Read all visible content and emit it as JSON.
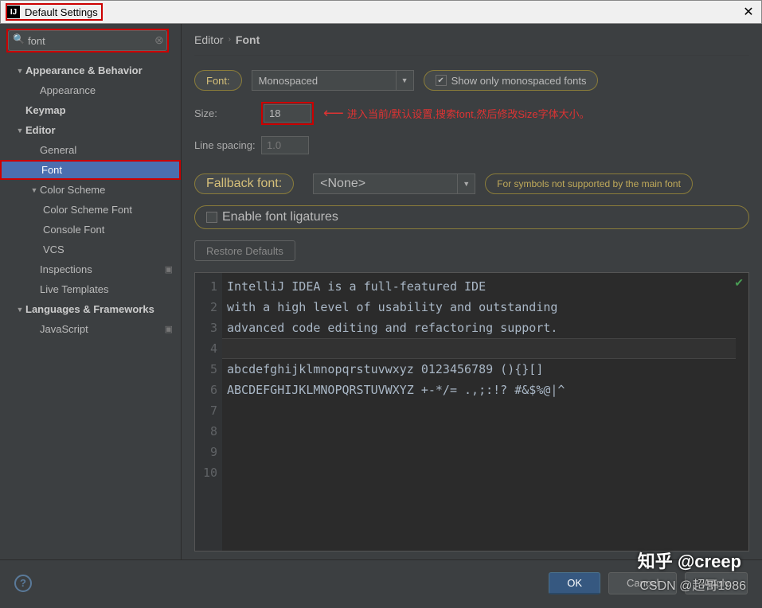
{
  "window": {
    "title": "Default Settings"
  },
  "search": {
    "value": "font"
  },
  "tree": {
    "appearance_behavior": "Appearance & Behavior",
    "appearance": "Appearance",
    "keymap": "Keymap",
    "editor": "Editor",
    "general": "General",
    "font": "Font",
    "color_scheme": "Color Scheme",
    "color_scheme_font": "Color Scheme Font",
    "console_font": "Console Font",
    "vcs": "VCS",
    "inspections": "Inspections",
    "live_templates": "Live Templates",
    "languages_frameworks": "Languages & Frameworks",
    "javascript": "JavaScript"
  },
  "breadcrumb": {
    "root": "Editor",
    "leaf": "Font"
  },
  "form": {
    "font_label": "Font:",
    "font_value": "Monospaced",
    "show_monospaced": "Show only monospaced fonts",
    "size_label": "Size:",
    "size_value": "18",
    "line_spacing_label": "Line spacing:",
    "line_spacing_value": "1.0",
    "fallback_label": "Fallback font:",
    "fallback_value": "<None>",
    "fallback_hint": "For symbols not supported by the main font",
    "ligatures": "Enable font ligatures",
    "restore": "Restore Defaults",
    "annotation": "进入当前/默认设置,搜索font,然后修改Size字体大小。"
  },
  "preview": {
    "lines": [
      "IntelliJ IDEA is a full-featured IDE",
      "with a high level of usability and outstanding",
      "advanced code editing and refactoring support.",
      "",
      "abcdefghijklmnopqrstuvwxyz 0123456789 (){}[]",
      "ABCDEFGHIJKLMNOPQRSTUVWXYZ +-*/= .,;:!? #&$%@|^",
      "",
      "",
      "",
      ""
    ]
  },
  "footer": {
    "ok": "OK",
    "cancel": "Cancel",
    "apply": "Apply"
  },
  "watermark": {
    "w1": "知乎 @creep",
    "w2": "CSDN @超哥1986"
  }
}
